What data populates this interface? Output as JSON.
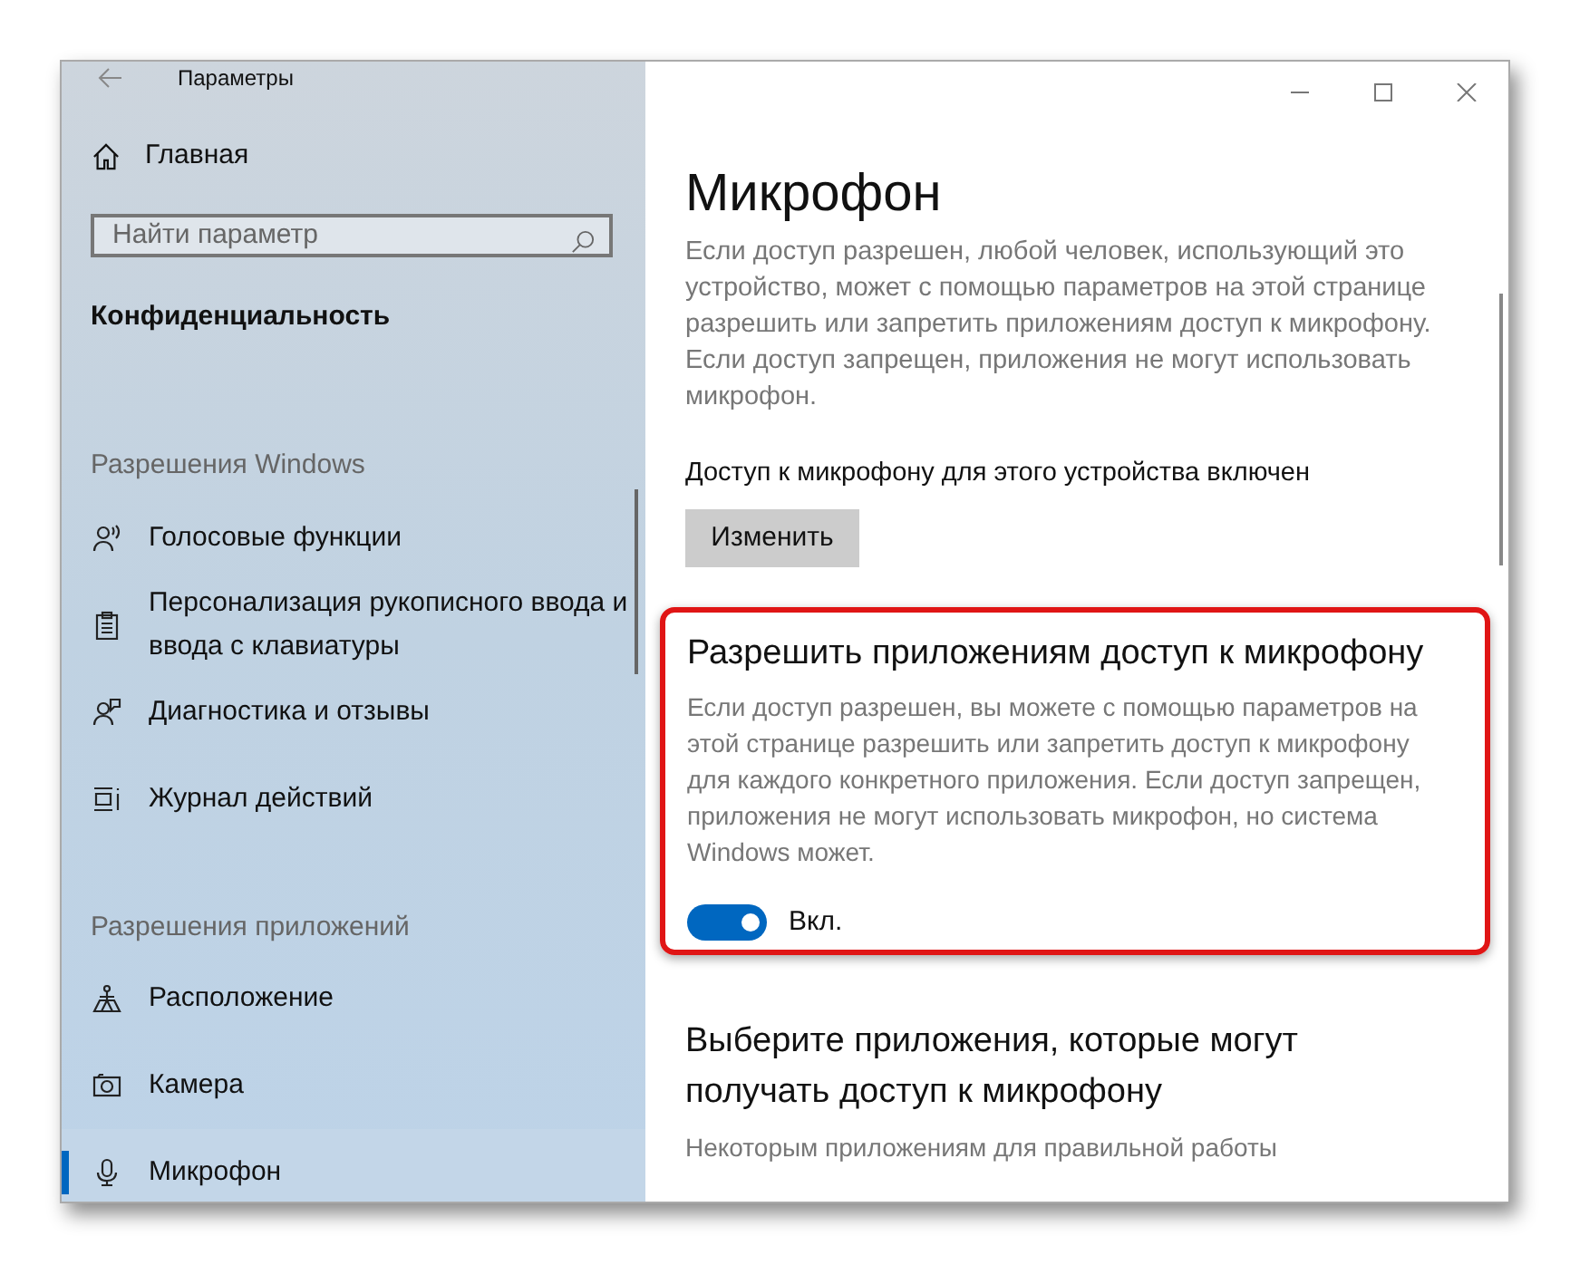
{
  "window": {
    "title": "Параметры"
  },
  "sidebar": {
    "home": "Главная",
    "search": {
      "placeholder": "Найти параметр"
    },
    "category": "Конфиденциальность",
    "groups": [
      {
        "title": "Разрешения Windows",
        "items": [
          {
            "label": "Голосовые функции",
            "selected": false
          },
          {
            "label": "Персонализация рукописного ввода и ввода с клавиатуры",
            "selected": false
          },
          {
            "label": "Диагностика и отзывы",
            "selected": false
          },
          {
            "label": "Журнал действий",
            "selected": false
          }
        ]
      },
      {
        "title": "Разрешения приложений",
        "items": [
          {
            "label": "Расположение",
            "selected": false
          },
          {
            "label": "Камера",
            "selected": false
          },
          {
            "label": "Микрофон",
            "selected": true
          }
        ]
      }
    ]
  },
  "content": {
    "title": "Микрофон",
    "description": "Если доступ разрешен, любой человек, использующий это устройство, может с помощью параметров на этой странице разрешить или запретить приложениям доступ к микрофону. Если доступ запрещен, приложения не могут использовать микрофон.",
    "device_status": "Доступ к микрофону для этого устройства включен",
    "change_button": "Изменить",
    "app_access": {
      "highlighted": true,
      "title": "Разрешить приложениям доступ к микрофону",
      "description": "Если доступ разрешен, вы можете с помощью параметров на этой странице разрешить или запретить доступ к микрофону для каждого конкретного приложения. Если доступ запрещен, приложения не могут использовать микрофон, но система Windows может.",
      "toggle": {
        "on": true,
        "label": "Вкл."
      }
    },
    "choose_apps": {
      "title": "Выберите приложения, которые могут получать доступ к микрофону",
      "description": "Некоторым приложениям для правильной работы"
    }
  }
}
